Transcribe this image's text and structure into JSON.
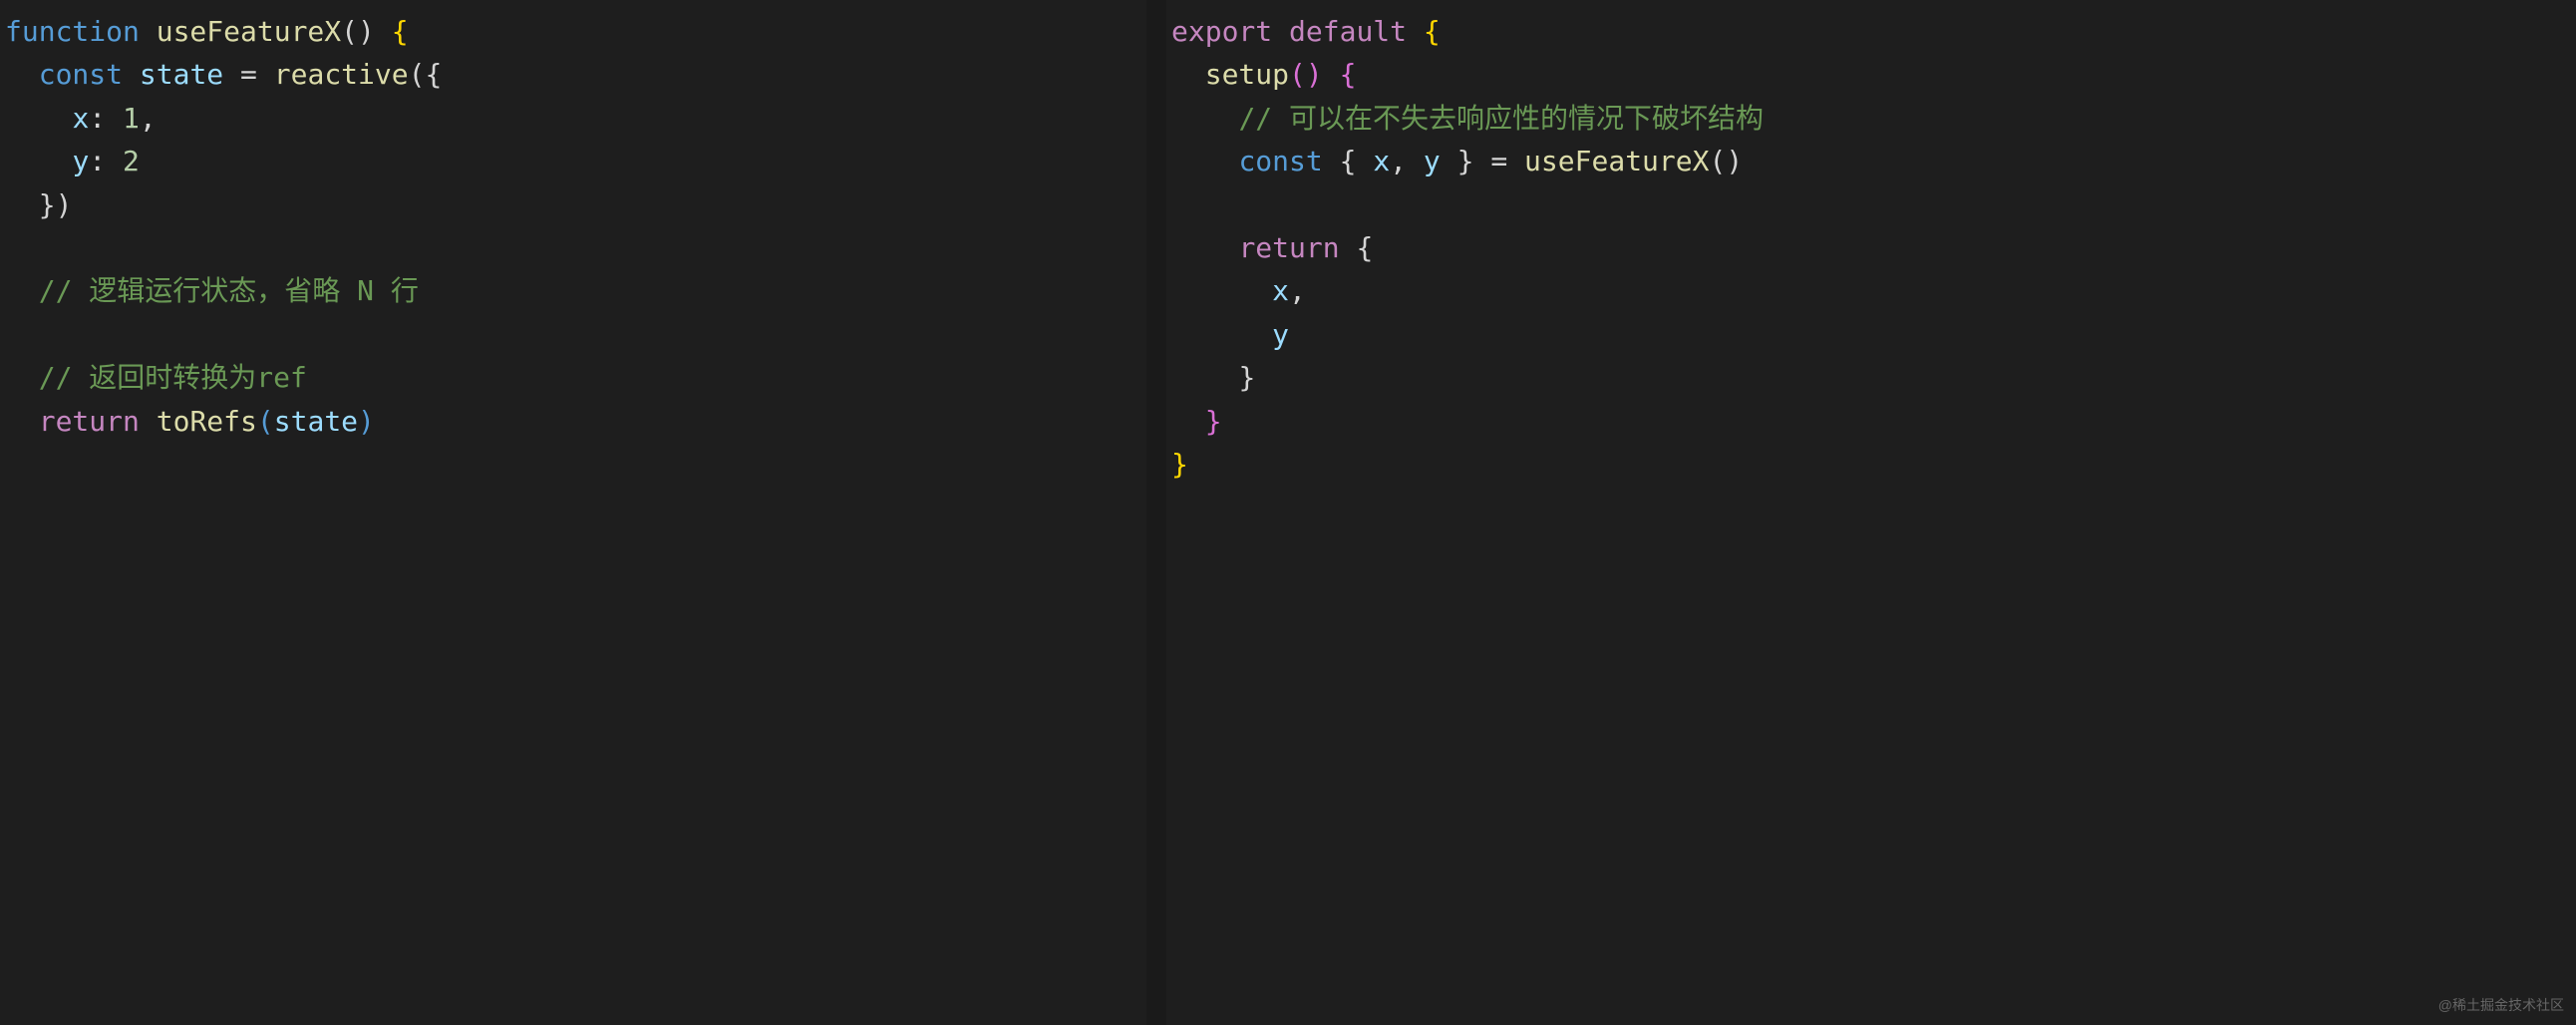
{
  "left": {
    "l1": {
      "kw": "function",
      "fn": "useFeatureX",
      "p1": "()",
      "b1": " {"
    },
    "l2": {
      "kw": "const",
      "var": "state",
      "eq": " = ",
      "fn": "reactive",
      "p1": "({"
    },
    "l3": {
      "prop": "x",
      "colon": ": ",
      "num": "1",
      "comma": ","
    },
    "l4": {
      "prop": "y",
      "colon": ": ",
      "num": "2"
    },
    "l5": {
      "close": "})"
    },
    "l6": {
      "comment": "// 逻辑运行状态，省略 N 行"
    },
    "l7": {
      "comment": "// 返回时转换为ref"
    },
    "l8": {
      "kw": "return",
      "fn": "toRefs",
      "p1": "(",
      "var": "state",
      "p2": ")"
    }
  },
  "right": {
    "l1": {
      "kw1": "export",
      "kw2": "default",
      "b1": " {"
    },
    "l2": {
      "fn": "setup",
      "p1": "()",
      "b1": " {"
    },
    "l3": {
      "comment": "// 可以在不失去响应性的情况下破坏结构"
    },
    "l4": {
      "kw": "const",
      "b1": "{ ",
      "v1": "x",
      "c1": ", ",
      "v2": "y",
      "b2": " }",
      "eq": " = ",
      "fn": "useFeatureX",
      "p1": "()"
    },
    "l5": {
      "kw": "return",
      "b1": " {"
    },
    "l6": {
      "v1": "x",
      "c1": ","
    },
    "l7": {
      "v1": "y"
    },
    "l8": {
      "close": "}"
    },
    "l9": {
      "close": "}"
    },
    "l10": {
      "close": "}"
    }
  },
  "watermark": "@稀土掘金技术社区"
}
